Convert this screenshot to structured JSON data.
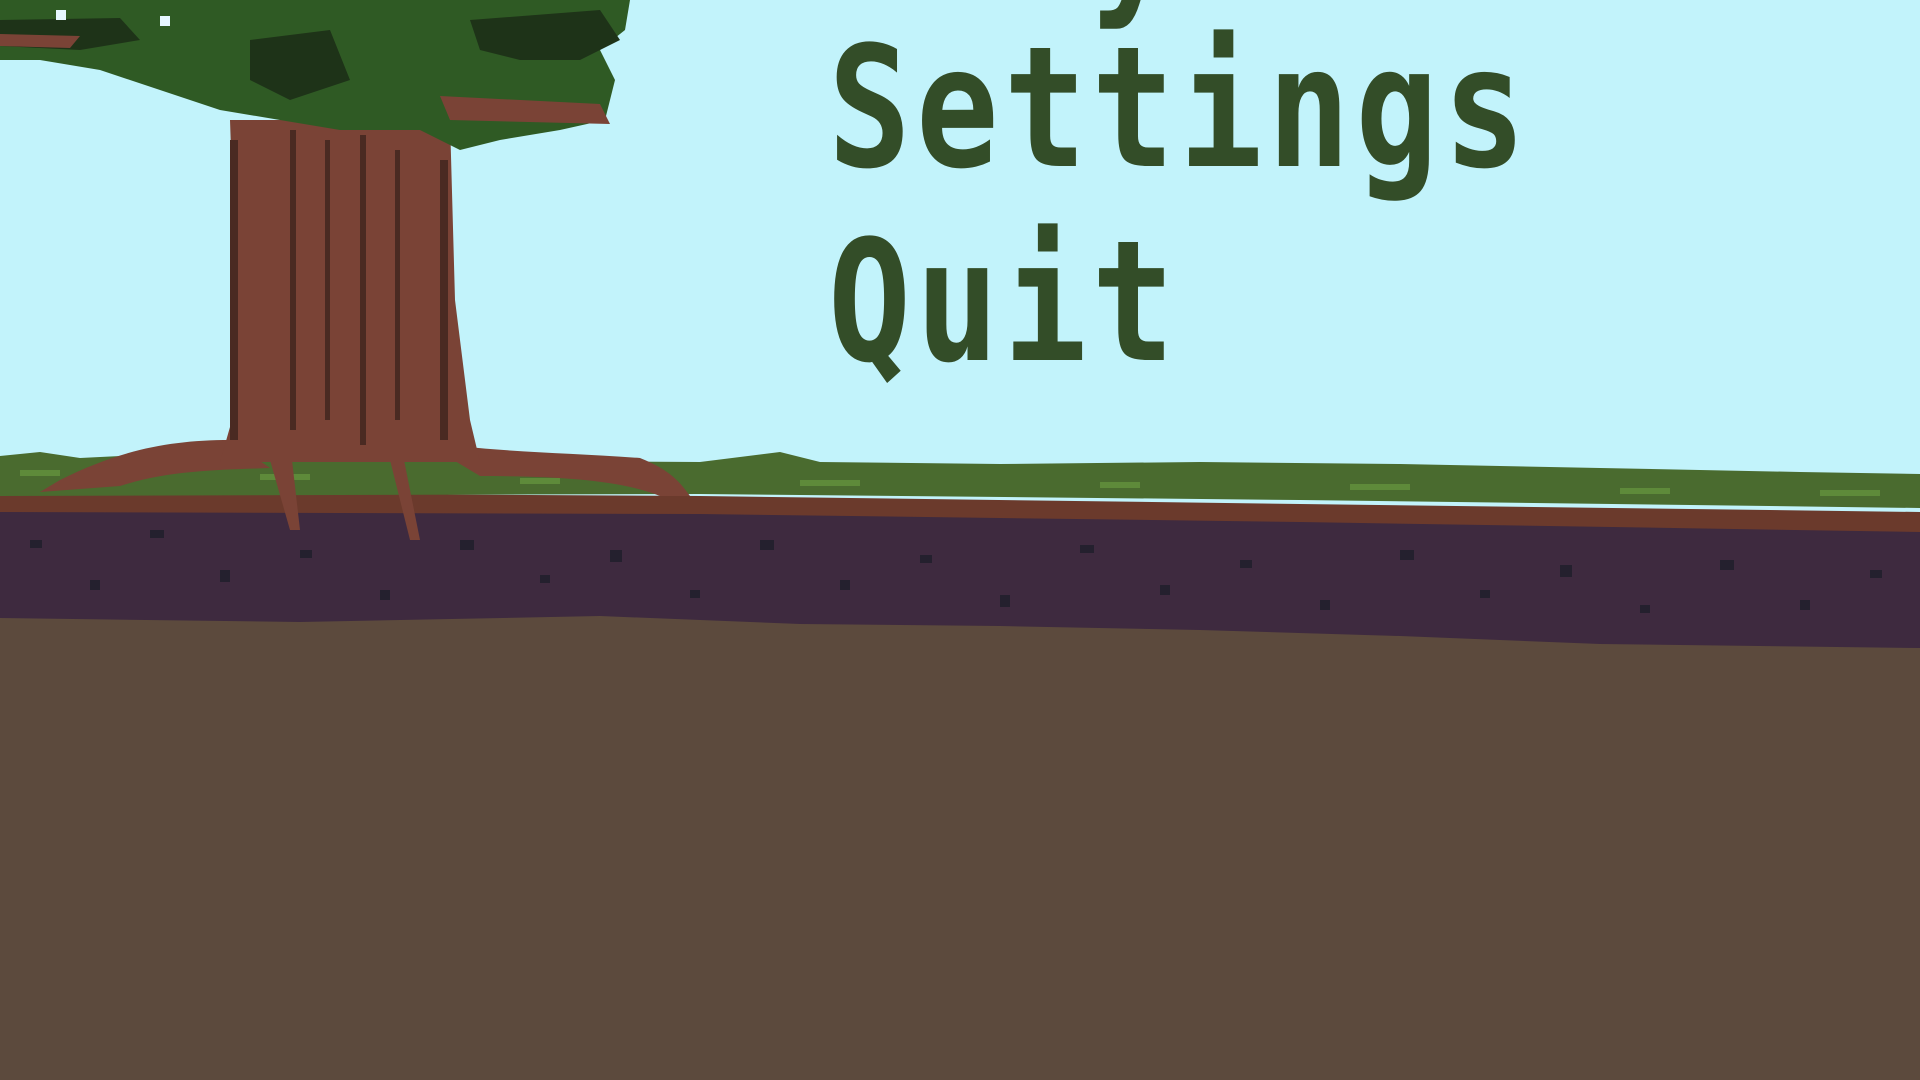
{
  "menu": {
    "items": [
      {
        "label": "Settings"
      },
      {
        "label": "Quit"
      }
    ]
  },
  "colors": {
    "sky": "#c2f3fb",
    "menu_text": "#334d28",
    "grass": "#4a6b2f",
    "topsoil": "#6b3a2c",
    "dark_soil": "#3e2a3f",
    "ground": "#5c4a3d",
    "bark": "#7a4336",
    "bark_dark": "#4a2a22",
    "foliage": "#2f5a24",
    "foliage_dark": "#1e3318"
  }
}
